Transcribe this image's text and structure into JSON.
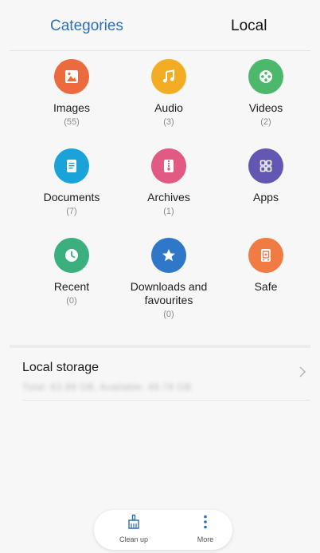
{
  "tabs": {
    "categories": "Categories",
    "local": "Local"
  },
  "colors": {
    "active_tab": "#2f6fb6"
  },
  "categories": [
    {
      "label": "Images",
      "count": "(55)",
      "icon": "image-icon",
      "color": "#ec6a3e"
    },
    {
      "label": "Audio",
      "count": "(3)",
      "icon": "music-note-icon",
      "color": "#f3ad25"
    },
    {
      "label": "Videos",
      "count": "(2)",
      "icon": "film-reel-icon",
      "color": "#4cb86b"
    },
    {
      "label": "Documents",
      "count": "(7)",
      "icon": "document-icon",
      "color": "#1aa3d8"
    },
    {
      "label": "Archives",
      "count": "(1)",
      "icon": "zip-archive-icon",
      "color": "#e25983"
    },
    {
      "label": "Apps",
      "count": "",
      "icon": "apps-grid-icon",
      "color": "#6258b3"
    },
    {
      "label": "Recent",
      "count": "(0)",
      "icon": "clock-icon",
      "color": "#3bb07e"
    },
    {
      "label": "Downloads and favourites",
      "count": "(0)",
      "icon": "star-icon",
      "color": "#2f77c8"
    },
    {
      "label": "Safe",
      "count": "",
      "icon": "safe-icon",
      "color": "#f07b43"
    }
  ],
  "local_storage": {
    "title": "Local storage",
    "subtitle": "Total: 63.99 GB, Available: 49.78 GB"
  },
  "bottom_bar": {
    "clean_up": "Clean up",
    "more": "More"
  }
}
